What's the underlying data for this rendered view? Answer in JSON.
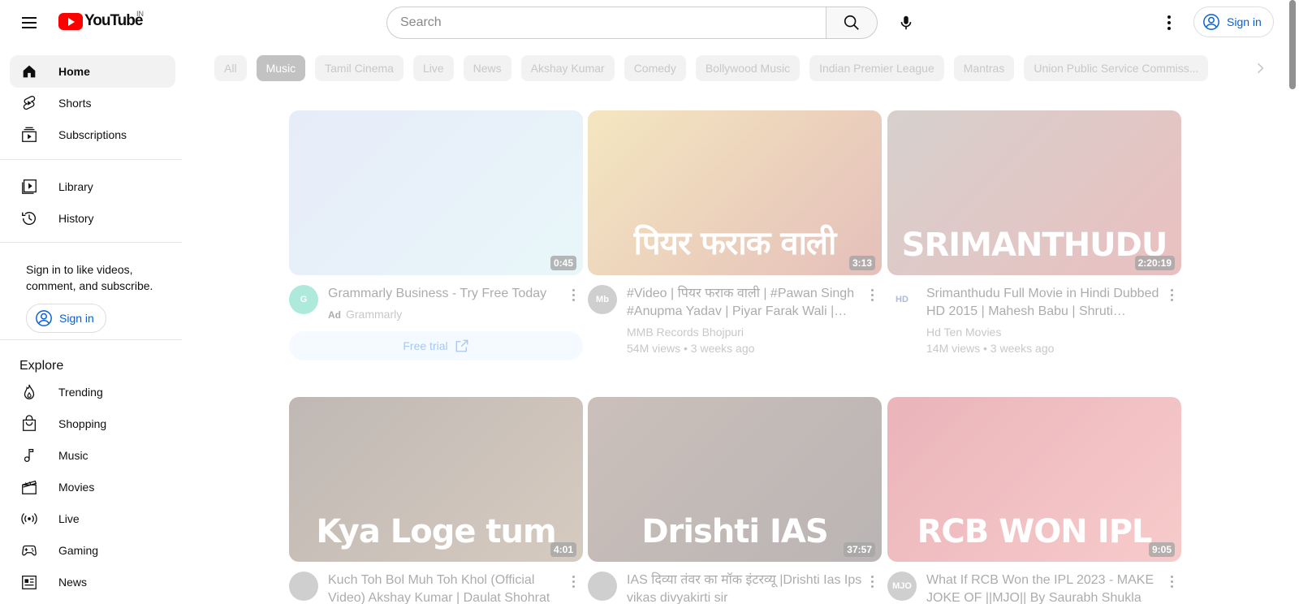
{
  "header": {
    "logo_text": "YouTube",
    "region": "IN",
    "search_placeholder": "Search",
    "sign_in": "Sign in"
  },
  "sidebar": {
    "primary": [
      {
        "label": "Home",
        "icon": "home-icon"
      },
      {
        "label": "Shorts",
        "icon": "shorts-icon"
      },
      {
        "label": "Subscriptions",
        "icon": "subscriptions-icon"
      }
    ],
    "library": [
      {
        "label": "Library",
        "icon": "library-icon"
      },
      {
        "label": "History",
        "icon": "history-icon"
      }
    ],
    "signin_prompt": "Sign in to like videos, comment, and subscribe.",
    "signin_button": "Sign in",
    "explore_title": "Explore",
    "explore": [
      {
        "label": "Trending",
        "icon": "trending-icon"
      },
      {
        "label": "Shopping",
        "icon": "shopping-icon"
      },
      {
        "label": "Music",
        "icon": "music-icon"
      },
      {
        "label": "Movies",
        "icon": "movies-icon"
      },
      {
        "label": "Live",
        "icon": "live-icon"
      },
      {
        "label": "Gaming",
        "icon": "gaming-icon"
      },
      {
        "label": "News",
        "icon": "news-icon"
      }
    ]
  },
  "chips": [
    "All",
    "Music",
    "Tamil Cinema",
    "Live",
    "News",
    "Akshay Kumar",
    "Comedy",
    "Bollywood Music",
    "Indian Premier League",
    "Mantras",
    "Union Public Service Commiss..."
  ],
  "active_chip": "Music",
  "videos": [
    {
      "title": "Grammarly Business - Try Free Today",
      "channel": "Grammarly",
      "ad": "Ad",
      "duration": "0:45",
      "cta": "Free trial",
      "avatar_text": "G",
      "caption": "",
      "colors": [
        "#b9c7ee",
        "#bfe6ee"
      ]
    },
    {
      "title": "#Video | पियर फराक वाली | #Pawan Singh #Anupma Yadav | Piyar Farak Wali | Ne...",
      "channel": "MMB Records Bhojpuri",
      "stats": "54M views • 3 weeks ago",
      "duration": "3:13",
      "avatar_text": "Mb",
      "caption": "पियर फराक वाली",
      "colors": [
        "#e0b84a",
        "#b34a3a"
      ]
    },
    {
      "title": "Srimanthudu Full Movie in Hindi Dubbed HD 2015 | Mahesh Babu | Shruti Haasa...",
      "channel": "Hd Ten Movies",
      "stats": "14M views • 3 weeks ago",
      "duration": "2:20:19",
      "avatar_text": "HD",
      "caption": "SRIMANTHUDU",
      "colors": [
        "#8a7a70",
        "#c24a4a"
      ]
    },
    {
      "title": "Kuch Toh Bol Muh Toh Khol (Official Video) Akshay Kumar | Daulat Shohrat",
      "channel": "",
      "stats": "",
      "duration": "4:01",
      "avatar_text": "",
      "caption": "Kya Loge tum",
      "colors": [
        "#4a3428",
        "#8a6a4a"
      ]
    },
    {
      "title": "IAS दिव्या तंवर का मॉक इंटरव्यू |Drishti Ias Ips vikas divyakirti sir",
      "channel": "",
      "stats": "",
      "duration": "37:57",
      "avatar_text": "",
      "caption": "Drishti IAS",
      "colors": [
        "#6a4a3a",
        "#3a2a2a"
      ]
    },
    {
      "title": "What If RCB Won the IPL 2023 - MAKE JOKE OF ||MJO|| By Saurabh Shukla",
      "channel": "",
      "stats": "",
      "duration": "9:05",
      "avatar_text": "MJO",
      "caption": "RCB WON IPL",
      "colors": [
        "#c42a3a",
        "#e86a6a"
      ]
    }
  ]
}
